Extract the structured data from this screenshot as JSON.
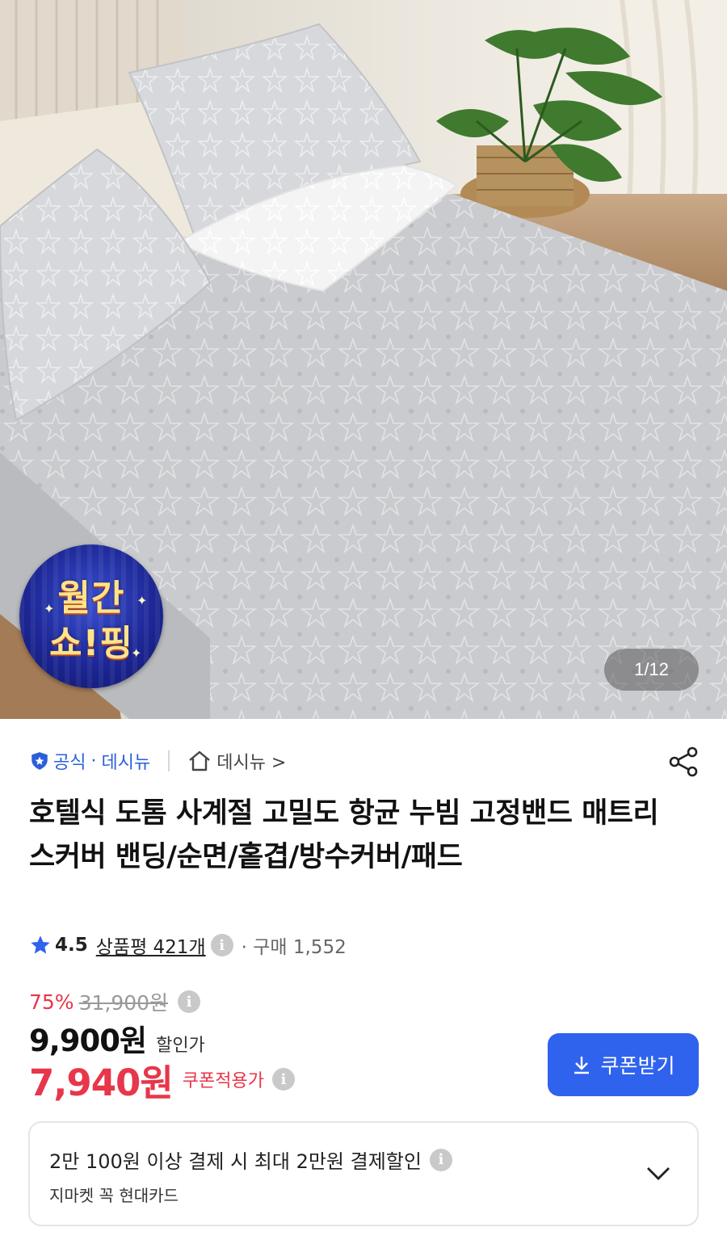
{
  "gallery": {
    "counter": "1/12",
    "badge": {
      "line1": "월간",
      "line2": "쇼!핑"
    }
  },
  "seller": {
    "official": "공식",
    "separator": "·",
    "name": "데시뉴",
    "shop_link": "데시뉴 >"
  },
  "product": {
    "title": "호텔식 도톰 사계절 고밀도 항균 누빔 고정밴드 매트리스커버 밴딩/순면/홑겹/방수커버/패드"
  },
  "rating": {
    "score": "4.5",
    "reviews": "상품평 421개",
    "purchases": "· 구매 1,552"
  },
  "price": {
    "discount_pct": "75%",
    "original": "31,900원",
    "sale": "9,900원",
    "sale_label": "할인가",
    "coupon_price": "7,940원",
    "coupon_label": "쿠폰적용가",
    "coupon_button": "쿠폰받기"
  },
  "promo": {
    "main": "2만 100원 이상 결제 시 최대 2만원 결제할인",
    "sub": "지마켓 꼭 현대카드"
  },
  "icons": {
    "official": "shield-icon",
    "shop": "home-icon",
    "share": "share-icon",
    "rating": "star-icon",
    "info": "info-icon",
    "download": "download-icon",
    "expand": "chevron-down-icon"
  },
  "colors": {
    "accent_blue": "#2f63ee",
    "official_blue": "#2b5fd9",
    "discount_red": "#e8364a",
    "star_blue": "#2f63ee"
  }
}
